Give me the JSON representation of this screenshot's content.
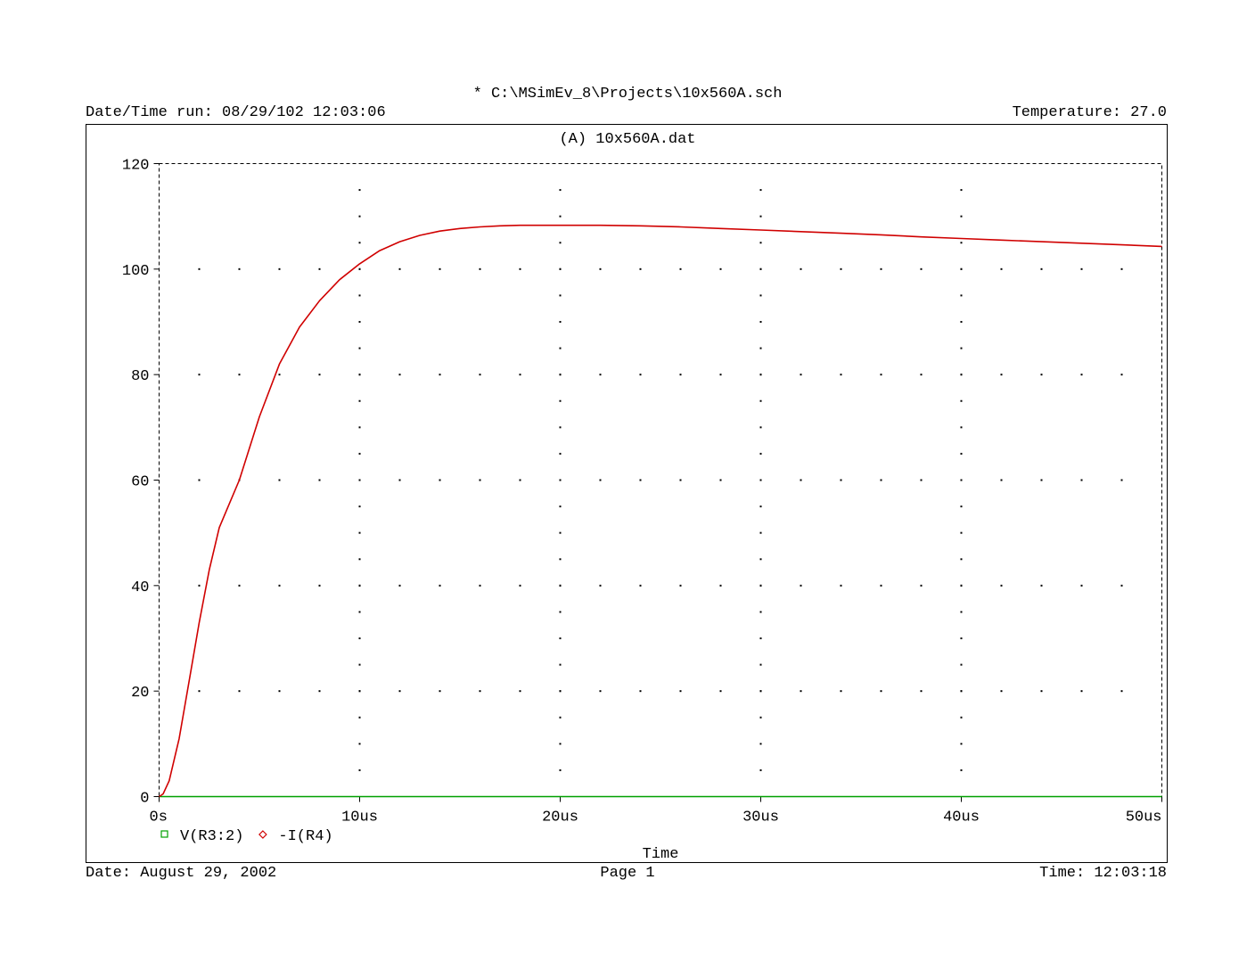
{
  "header": {
    "file_path": "* C:\\MSimEv_8\\Projects\\10x560A.sch",
    "run_datetime": "Date/Time run: 08/29/102 12:03:06",
    "temperature": "Temperature: 27.0"
  },
  "footer": {
    "date": "Date: August 29, 2002",
    "page": "Page 1",
    "time": "Time: 12:03:18"
  },
  "chart_data": {
    "type": "line",
    "title": "(A)  10x560A.dat",
    "xlabel": "Time",
    "ylabel": "",
    "xlim": [
      0,
      50
    ],
    "ylim": [
      0,
      120
    ],
    "x_ticks": [
      0,
      10,
      20,
      30,
      40,
      50
    ],
    "x_tick_labels": [
      "0s",
      "10us",
      "20us",
      "30us",
      "40us",
      "50us"
    ],
    "y_ticks": [
      0,
      20,
      40,
      60,
      80,
      100,
      120
    ],
    "y_tick_labels": [
      "0",
      "20",
      "40",
      "60",
      "80",
      "100",
      "120"
    ],
    "grid": "dotted",
    "legend_position": "bottom-left",
    "series": [
      {
        "name": "V(R3:2)",
        "marker": "square",
        "color": "#00a000",
        "x": [
          0,
          50
        ],
        "y": [
          0,
          0
        ]
      },
      {
        "name": "-I(R4)",
        "marker": "diamond",
        "color": "#d00000",
        "x": [
          0,
          0.2,
          0.5,
          1,
          1.5,
          2,
          2.5,
          3,
          4,
          5,
          6,
          7,
          8,
          9,
          10,
          11,
          12,
          13,
          14,
          15,
          16,
          17,
          18,
          20,
          22,
          24,
          26,
          28,
          30,
          32,
          34,
          36,
          38,
          40,
          42,
          44,
          46,
          48,
          50
        ],
        "y": [
          0,
          0.5,
          3,
          11,
          22,
          33,
          43,
          51,
          60,
          72,
          82,
          89,
          94,
          98,
          101,
          103.5,
          105.2,
          106.4,
          107.2,
          107.7,
          108,
          108.2,
          108.3,
          108.3,
          108.3,
          108.2,
          108,
          107.7,
          107.4,
          107.1,
          106.8,
          106.5,
          106.1,
          105.8,
          105.5,
          105.2,
          104.9,
          104.6,
          104.3
        ]
      }
    ]
  }
}
